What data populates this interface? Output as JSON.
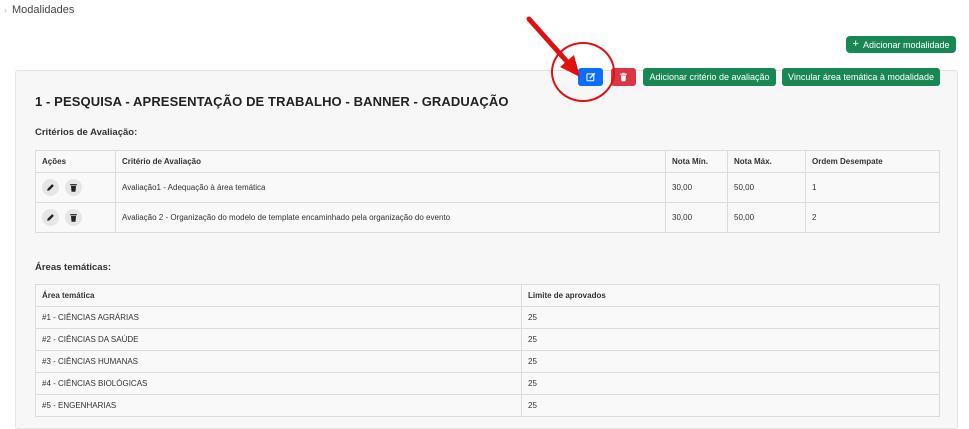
{
  "breadcrumb": {
    "current": "Modalidades"
  },
  "header": {
    "add_modalidade_label": "Adicionar modalidade"
  },
  "modalidade": {
    "title": "1 - PESQUISA - APRESENTAÇÃO DE TRABALHO - BANNER - GRADUAÇÃO",
    "add_criterio_label": "Adicionar critério de avaliação",
    "vincular_area_label": "Vincular área temática à modalidade",
    "criterios_heading": "Critérios de Avaliação:",
    "areas_heading": "Áreas temáticas:"
  },
  "criterios": {
    "columns": [
      "Ações",
      "Critério de Avaliação",
      "Nota Mín.",
      "Nota Máx.",
      "Ordem Desempate"
    ],
    "rows": [
      {
        "criterio": "Avaliação1 - Adequação à área temática",
        "nota_min": "30,00",
        "nota_max": "50,00",
        "ordem": "1"
      },
      {
        "criterio": "Avaliação 2 - Organização do modelo de template encaminhado pela organização do evento",
        "nota_min": "30,00",
        "nota_max": "50,00",
        "ordem": "2"
      }
    ]
  },
  "areas": {
    "columns": [
      "Área temática",
      "Limite de aprovados"
    ],
    "rows": [
      {
        "area": "#1 - CIÊNCIAS AGRÁRIAS",
        "limite": "25"
      },
      {
        "area": "#2 - CIÊNCIAS DA SAÚDE",
        "limite": "25"
      },
      {
        "area": "#3 - CIÊNCIAS HUMANAS",
        "limite": "25"
      },
      {
        "area": "#4 - CIÊNCIAS BIOLÓGICAS",
        "limite": "25"
      },
      {
        "area": "#5 - ENGENHARIAS",
        "limite": "25"
      }
    ]
  },
  "colors": {
    "green": "#198754",
    "blue": "#0d6efd",
    "red": "#dc3545",
    "annotation": "#e01010"
  },
  "icons": [
    "chevron-right-icon",
    "plus-icon",
    "edit-icon",
    "trash-icon",
    "pencil-icon",
    "arrow-annotation-icon"
  ]
}
